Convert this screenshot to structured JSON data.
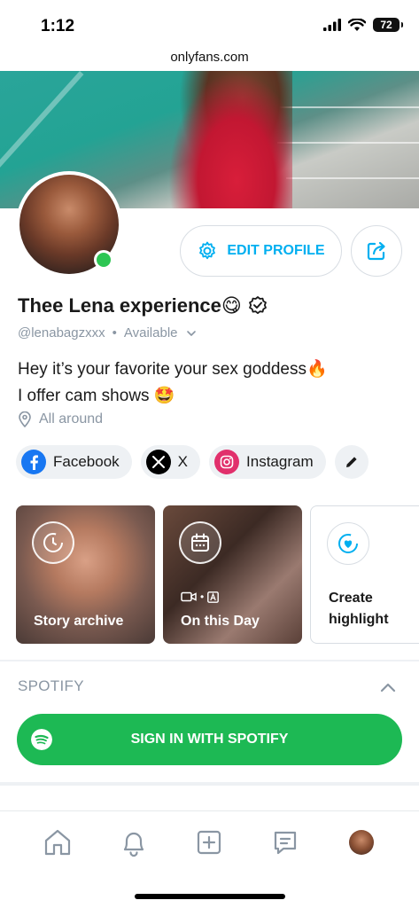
{
  "status_bar": {
    "time": "1:12",
    "battery": "72"
  },
  "browser": {
    "url": "onlyfans.com"
  },
  "profile": {
    "edit_label": "EDIT PROFILE",
    "name": "Thee Lena experience😋",
    "handle": "@lenabagzxxx",
    "status": "Available",
    "bio_line1": "Hey it’s your favorite your sex goddess🔥",
    "bio_line2": "I offer cam shows 🤩",
    "location": "All around"
  },
  "socials": [
    {
      "label": "Facebook",
      "icon": "facebook-icon",
      "color": "#1877f2"
    },
    {
      "label": "X",
      "icon": "x-icon",
      "color": "#000000"
    },
    {
      "label": "Instagram",
      "icon": "instagram-icon",
      "color": "#e1306c"
    }
  ],
  "highlights": {
    "archive_label": "Story archive",
    "onday_label": "On this Day",
    "create_line1": "Create",
    "create_line2": "highlight"
  },
  "spotify": {
    "title": "SPOTIFY",
    "button_label": "SIGN IN WITH SPOTIFY",
    "color": "#1db954"
  },
  "nav": [
    "home-icon",
    "bell-icon",
    "plus-square-icon",
    "message-icon",
    "profile-avatar"
  ],
  "colors": {
    "accent": "#00aff0",
    "online": "#2dc653",
    "muted": "#8a96a3"
  }
}
